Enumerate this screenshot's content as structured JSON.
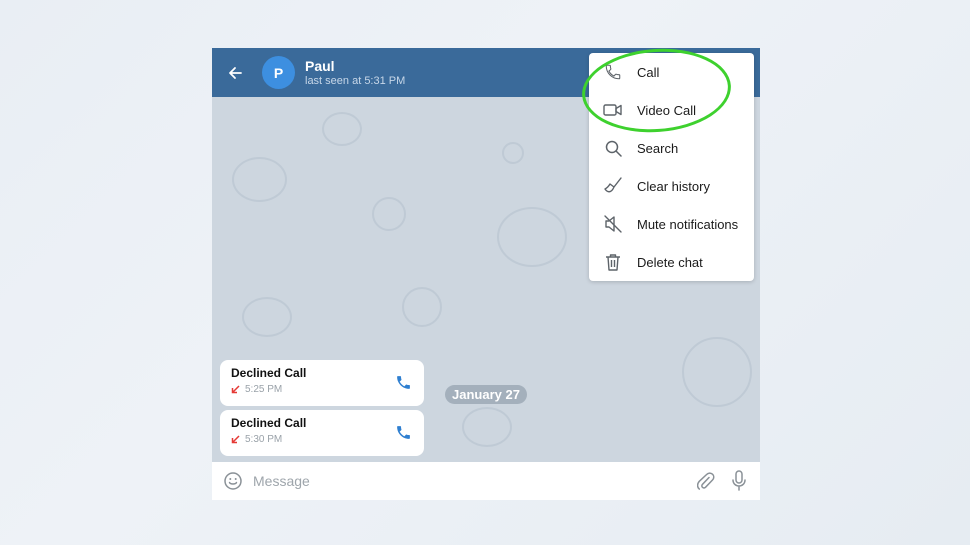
{
  "header": {
    "contact_name": "Paul",
    "status": "last seen at 5:31 PM",
    "avatar_initial": "P"
  },
  "chat": {
    "date_separator": "January 27",
    "messages": [
      {
        "title": "Declined Call",
        "time": "5:25 PM",
        "direction": "incoming-declined"
      },
      {
        "title": "Declined Call",
        "time": "5:30 PM",
        "direction": "incoming-declined"
      }
    ]
  },
  "input": {
    "placeholder": "Message",
    "value": ""
  },
  "menu": {
    "items": [
      {
        "label": "Call",
        "icon": "phone-icon"
      },
      {
        "label": "Video Call",
        "icon": "video-camera-icon"
      },
      {
        "label": "Search",
        "icon": "search-icon"
      },
      {
        "label": "Clear history",
        "icon": "broom-icon"
      },
      {
        "label": "Mute notifications",
        "icon": "mute-icon"
      },
      {
        "label": "Delete chat",
        "icon": "trash-icon"
      }
    ]
  },
  "colors": {
    "header": "#3a6a9a",
    "avatar": "#3d8fe0",
    "highlight": "#3ed12e",
    "declined_arrow": "#e53935",
    "call_icon": "#2f7fd0"
  }
}
